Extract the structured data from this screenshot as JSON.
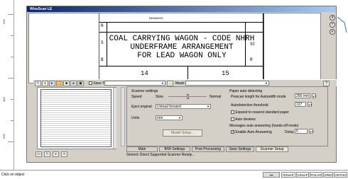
{
  "ruler": {
    "labels": [
      "200",
      "400",
      "600"
    ]
  },
  "window": {
    "title": "WiseScan LE"
  },
  "drawing": {
    "lines": [
      "COAL CARRYING WAGON - CODE NHRH",
      "UNDERFRAME ARRANGEMENT",
      "FOR LEAD WAGON ONLY"
    ],
    "margin_labels": [
      "R",
      "S",
      "B"
    ],
    "side_labels": [
      "SC",
      "R"
    ],
    "numbers": [
      "14",
      "15"
    ],
    "top_text": "REMARKS"
  },
  "side_buttons": [
    "d",
    "f",
    "e"
  ],
  "toolbar": {
    "save_to_label": "Save To:",
    "save_to_value": "",
    "mask_label": "Mask:",
    "mask_value": "",
    "browse_label": "..."
  },
  "scanner": {
    "heading": "Scanner settings",
    "speed_label": "Speed",
    "speed_slow": "Slow",
    "speed_normal": "Normal",
    "eject_label": "Eject original",
    "eject_value": "Unload forward",
    "units_label": "Units",
    "units_value": "mm",
    "model_setup": "Model Setup..."
  },
  "paper": {
    "heading": "Paper auto detecting",
    "prescan_label": "Prescan length for Autowidth mode",
    "prescan_value": "200 mm",
    "threshold_label": "Autodetection threshold",
    "threshold_value": "127",
    "expand_label": "Expand to nearest standard paper",
    "deskew_label": "Auto deskew",
    "messages_heading": "Messages auto answering (hands-off mode)",
    "enable_label": "Enable Auto Answering",
    "delay_label": "Delay",
    "delay_value": "5"
  },
  "tabs": [
    "Main",
    "B/W Settings",
    "Post Processing",
    "Save Settings",
    "Scanner Setup"
  ],
  "scanner_status": "Generic Direct Supported Scanner Ready...",
  "status_bar": {
    "left_text": "Click on object",
    "toggles": [
      "RSNAP",
      "VSNAP",
      "POLAR",
      "GRID",
      "ORTHO"
    ]
  }
}
